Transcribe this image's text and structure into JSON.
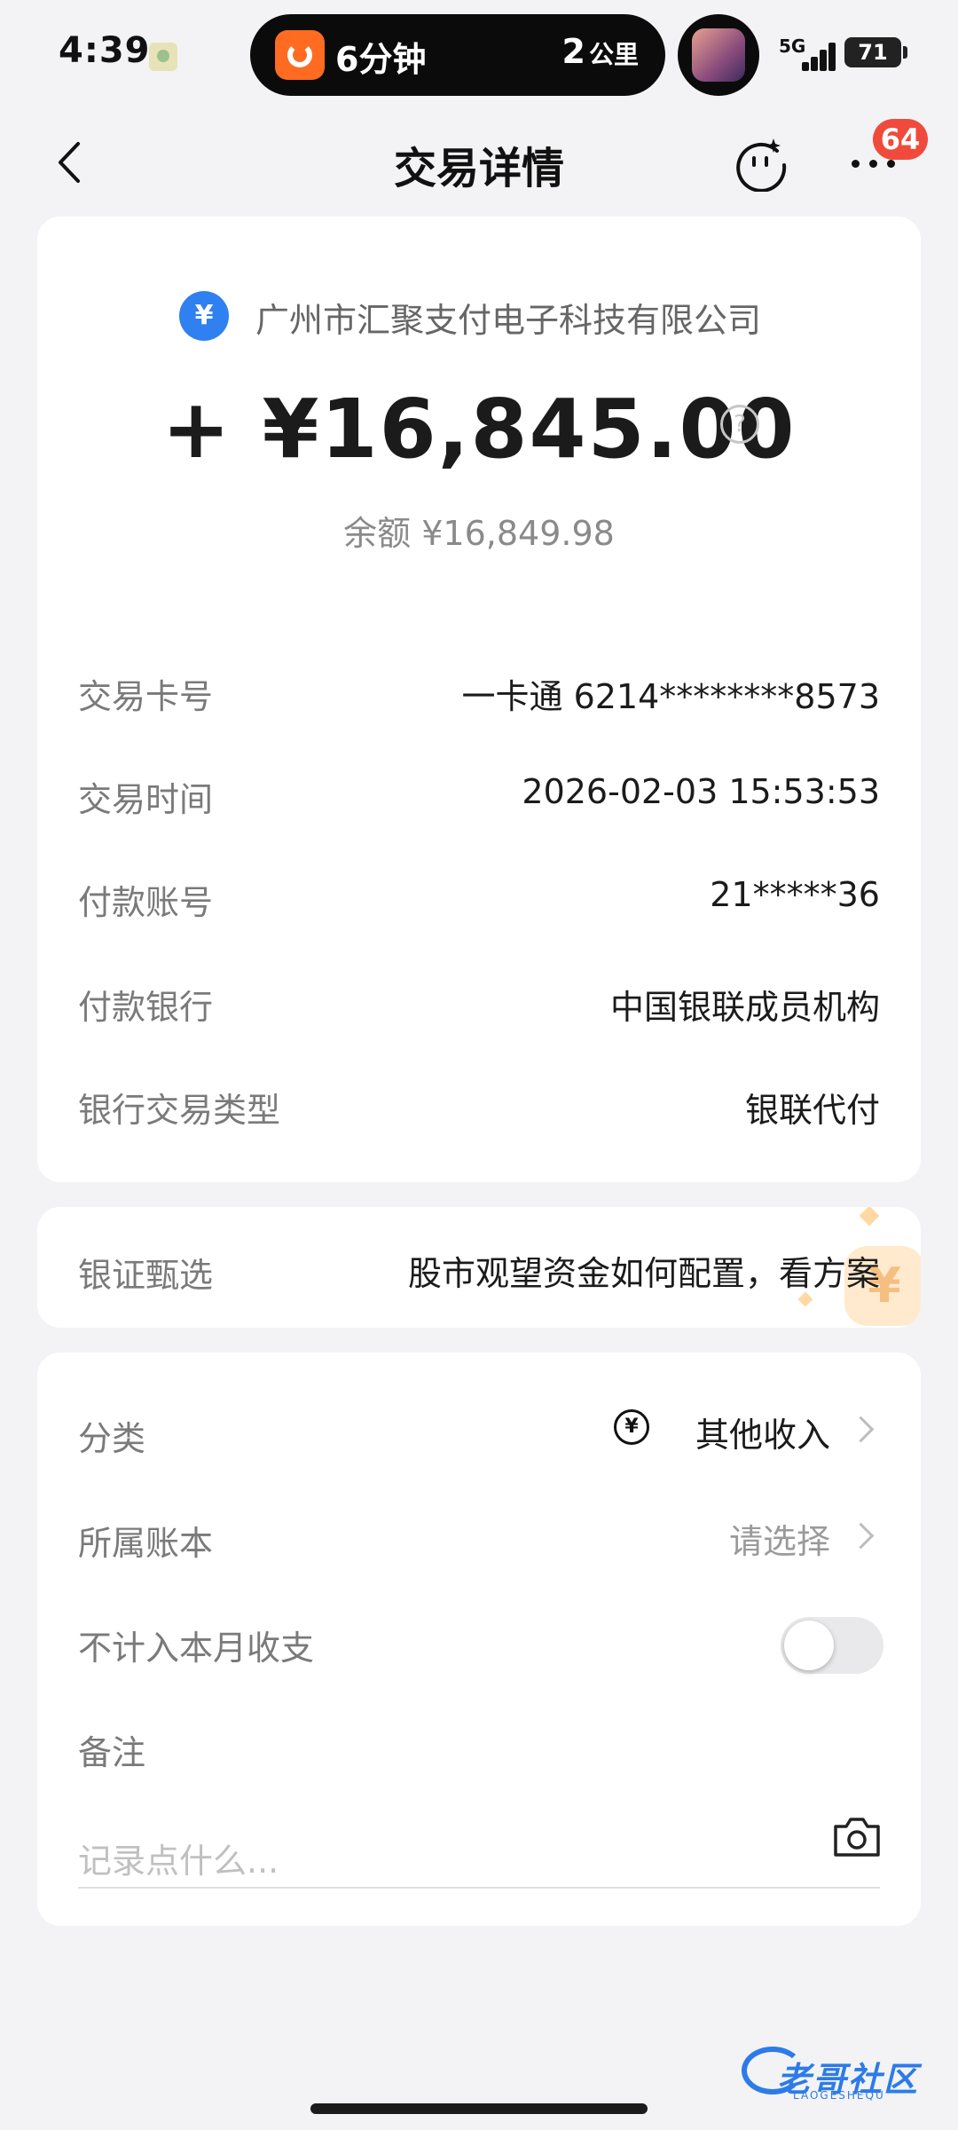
{
  "status_bar": {
    "time": "4:39",
    "island_eta": "6分钟",
    "island_distance_value": "2",
    "island_distance_unit": "公里",
    "network": "5G",
    "battery": "71"
  },
  "nav": {
    "title": "交易详情",
    "badge_count": "64"
  },
  "transaction": {
    "merchant_icon_glyph": "¥",
    "merchant": "广州市汇聚支付电子科技有限公司",
    "amount": "+ ¥16,845.00",
    "balance": "余额 ¥16,849.98",
    "rows": [
      {
        "label": "交易卡号",
        "value": "一卡通 6214********8573"
      },
      {
        "label": "交易时间",
        "value": "2026-02-03 15:53:53"
      },
      {
        "label": "付款账号",
        "value": "21*****36"
      },
      {
        "label": "付款银行",
        "value": "中国银联成员机构"
      },
      {
        "label": "银行交易类型",
        "value": "银联代付"
      }
    ]
  },
  "promo": {
    "label": "银证甄选",
    "text": "股市观望资金如何配置，看方案",
    "deco_glyph": "¥"
  },
  "settings": {
    "category_label": "分类",
    "category_icon_glyph": "¥",
    "category_value": "其他收入",
    "ledger_label": "所属账本",
    "ledger_value": "请选择",
    "exclude_label": "不计入本月收支",
    "exclude_enabled": false,
    "note_label": "备注",
    "note_placeholder": "记录点什么..."
  },
  "watermark": {
    "text": "老哥社区",
    "sub": "LAOGESHEQU"
  },
  "colors": {
    "accent_blue": "#2f80f0",
    "badge_red": "#f04a3d",
    "didi_orange": "#ff6b21"
  }
}
